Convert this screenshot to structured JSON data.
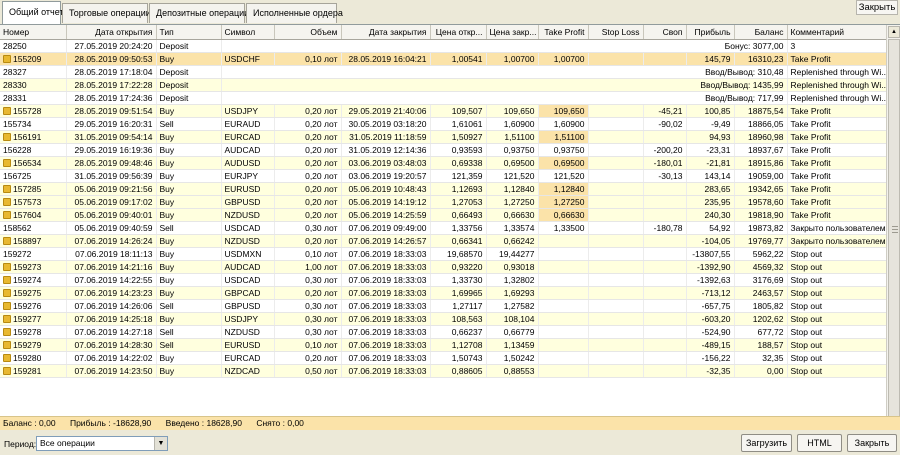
{
  "tabs": [
    "Общий отчет",
    "Торговые операции",
    "Депозитные операции",
    "Исполненные ордера"
  ],
  "close_top_label": "Закрыть",
  "columns": [
    "Номер",
    "Дата открытия",
    "Тип",
    "Символ",
    "Объем",
    "Дата закрытия",
    "Цена откр...",
    "Цена закр...",
    "Take Profit",
    "Stop Loss",
    "Своп",
    "Прибыль",
    "Баланс",
    "Комментарий"
  ],
  "rows": [
    {
      "kind": "bal",
      "icon": false,
      "style": "w",
      "c": [
        "28250",
        "27.05.2019 20:24:20",
        "Deposit"
      ],
      "span": "Бонус: 3077,00",
      "comment": "3"
    },
    {
      "kind": "trade",
      "icon": true,
      "style": "sel",
      "c": [
        "155209",
        "28.05.2019 09:50:53",
        "Buy",
        "USDCHF",
        "0,10 лот",
        "28.05.2019 16:04:21",
        "1,00541",
        "1,00700",
        "1,00700",
        "",
        "",
        "145,79",
        "16310,23",
        "Take Profit"
      ]
    },
    {
      "kind": "bal",
      "icon": false,
      "style": "w",
      "c": [
        "28327",
        "28.05.2019 17:18:04",
        "Deposit"
      ],
      "span": "Ввод/Вывод: 310,48",
      "comment": "Replenished through Wi..."
    },
    {
      "kind": "bal",
      "icon": false,
      "style": "y",
      "c": [
        "28330",
        "28.05.2019 17:22:28",
        "Deposit"
      ],
      "span": "Ввод/Вывод: 1435,99",
      "comment": "Replenished through Wi..."
    },
    {
      "kind": "bal",
      "icon": false,
      "style": "w",
      "c": [
        "28331",
        "28.05.2019 17:24:36",
        "Deposit"
      ],
      "span": "Ввод/Вывод: 717,99",
      "comment": "Replenished through Wi..."
    },
    {
      "kind": "trade",
      "icon": true,
      "style": "y",
      "c": [
        "155728",
        "28.05.2019 09:51:54",
        "Buy",
        "USDJPY",
        "0,20 лот",
        "29.05.2019 21:40:06",
        "109,507",
        "109,650",
        "109,650",
        "",
        "-45,21",
        "100,85",
        "18875,54",
        "Take Profit"
      ]
    },
    {
      "kind": "trade",
      "icon": false,
      "style": "w",
      "c": [
        "155734",
        "29.05.2019 16:20:31",
        "Sell",
        "EURAUD",
        "0,20 лот",
        "30.05.2019 03:18:20",
        "1,61061",
        "1,60900",
        "1,60900",
        "",
        "-90,02",
        "-9,49",
        "18866,05",
        "Take Profit"
      ]
    },
    {
      "kind": "trade",
      "icon": true,
      "style": "y",
      "c": [
        "156191",
        "31.05.2019 09:54:14",
        "Buy",
        "EURCAD",
        "0,20 лот",
        "31.05.2019 11:18:59",
        "1,50927",
        "1,51100",
        "1,51100",
        "",
        "",
        "94,93",
        "18960,98",
        "Take Profit"
      ]
    },
    {
      "kind": "trade",
      "icon": false,
      "style": "w",
      "c": [
        "156228",
        "29.05.2019 16:19:36",
        "Buy",
        "AUDCAD",
        "0,20 лот",
        "31.05.2019 12:14:36",
        "0,93593",
        "0,93750",
        "0,93750",
        "",
        "-200,20",
        "-23,31",
        "18937,67",
        "Take Profit"
      ]
    },
    {
      "kind": "trade",
      "icon": true,
      "style": "y",
      "c": [
        "156534",
        "28.05.2019 09:48:46",
        "Buy",
        "AUDUSD",
        "0,20 лот",
        "03.06.2019 03:48:03",
        "0,69338",
        "0,69500",
        "0,69500",
        "",
        "-180,01",
        "-21,81",
        "18915,86",
        "Take Profit"
      ]
    },
    {
      "kind": "trade",
      "icon": false,
      "style": "w",
      "c": [
        "156725",
        "31.05.2019 09:56:39",
        "Buy",
        "EURJPY",
        "0,20 лот",
        "03.06.2019 19:20:57",
        "121,359",
        "121,520",
        "121,520",
        "",
        "-30,13",
        "143,14",
        "19059,00",
        "Take Profit"
      ]
    },
    {
      "kind": "trade",
      "icon": true,
      "style": "y",
      "c": [
        "157285",
        "05.06.2019 09:21:56",
        "Buy",
        "EURUSD",
        "0,20 лот",
        "05.06.2019 10:48:43",
        "1,12693",
        "1,12840",
        "1,12840",
        "",
        "",
        "283,65",
        "19342,65",
        "Take Profit"
      ]
    },
    {
      "kind": "trade",
      "icon": true,
      "style": "y",
      "c": [
        "157573",
        "05.06.2019 09:17:02",
        "Buy",
        "GBPUSD",
        "0,20 лот",
        "05.06.2019 14:19:12",
        "1,27053",
        "1,27250",
        "1,27250",
        "",
        "",
        "235,95",
        "19578,60",
        "Take Profit"
      ]
    },
    {
      "kind": "trade",
      "icon": true,
      "style": "y",
      "c": [
        "157604",
        "05.06.2019 09:40:01",
        "Buy",
        "NZDUSD",
        "0,20 лот",
        "05.06.2019 14:25:59",
        "0,66493",
        "0,66630",
        "0,66630",
        "",
        "",
        "240,30",
        "19818,90",
        "Take Profit"
      ]
    },
    {
      "kind": "trade",
      "icon": false,
      "style": "w",
      "c": [
        "158562",
        "05.06.2019 09:40:59",
        "Sell",
        "USDCAD",
        "0,30 лот",
        "07.06.2019 09:49:00",
        "1,33756",
        "1,33574",
        "1,33500",
        "",
        "-180,78",
        "54,92",
        "19873,82",
        "Закрыто пользователем"
      ]
    },
    {
      "kind": "trade",
      "icon": true,
      "style": "y",
      "c": [
        "158897",
        "07.06.2019 14:26:24",
        "Buy",
        "NZDUSD",
        "0,20 лот",
        "07.06.2019 14:26:57",
        "0,66341",
        "0,66242",
        "",
        "",
        "",
        "-104,05",
        "19769,77",
        "Закрыто пользователем"
      ]
    },
    {
      "kind": "trade",
      "icon": false,
      "style": "w",
      "c": [
        "159272",
        "07.06.2019 18:11:13",
        "Buy",
        "USDMXN",
        "0,10 лот",
        "07.06.2019 18:33:03",
        "19,68570",
        "19,44277",
        "",
        "",
        "",
        "-13807,55",
        "5962,22",
        "Stop out"
      ]
    },
    {
      "kind": "trade",
      "icon": true,
      "style": "y",
      "c": [
        "159273",
        "07.06.2019 14:21:16",
        "Buy",
        "AUDCAD",
        "1,00 лот",
        "07.06.2019 18:33:03",
        "0,93220",
        "0,93018",
        "",
        "",
        "",
        "-1392,90",
        "4569,32",
        "Stop out"
      ]
    },
    {
      "kind": "trade",
      "icon": true,
      "style": "w",
      "c": [
        "159274",
        "07.06.2019 14:22:55",
        "Buy",
        "USDCAD",
        "0,30 лот",
        "07.06.2019 18:33:03",
        "1,33730",
        "1,32802",
        "",
        "",
        "",
        "-1392,63",
        "3176,69",
        "Stop out"
      ]
    },
    {
      "kind": "trade",
      "icon": true,
      "style": "y",
      "c": [
        "159275",
        "07.06.2019 14:23:23",
        "Buy",
        "GBPCAD",
        "0,20 лот",
        "07.06.2019 18:33:03",
        "1,69965",
        "1,69293",
        "",
        "",
        "",
        "-713,12",
        "2463,57",
        "Stop out"
      ]
    },
    {
      "kind": "trade",
      "icon": true,
      "style": "w",
      "c": [
        "159276",
        "07.06.2019 14:26:06",
        "Sell",
        "GBPUSD",
        "0,30 лот",
        "07.06.2019 18:33:03",
        "1,27117",
        "1,27582",
        "",
        "",
        "",
        "-657,75",
        "1805,82",
        "Stop out"
      ]
    },
    {
      "kind": "trade",
      "icon": true,
      "style": "y",
      "c": [
        "159277",
        "07.06.2019 14:25:18",
        "Buy",
        "USDJPY",
        "0,30 лот",
        "07.06.2019 18:33:03",
        "108,563",
        "108,104",
        "",
        "",
        "",
        "-603,20",
        "1202,62",
        "Stop out"
      ]
    },
    {
      "kind": "trade",
      "icon": true,
      "style": "w",
      "c": [
        "159278",
        "07.06.2019 14:27:18",
        "Sell",
        "NZDUSD",
        "0,30 лот",
        "07.06.2019 18:33:03",
        "0,66237",
        "0,66779",
        "",
        "",
        "",
        "-524,90",
        "677,72",
        "Stop out"
      ]
    },
    {
      "kind": "trade",
      "icon": true,
      "style": "y",
      "c": [
        "159279",
        "07.06.2019 14:28:30",
        "Sell",
        "EURUSD",
        "0,10 лот",
        "07.06.2019 18:33:03",
        "1,12708",
        "1,13459",
        "",
        "",
        "",
        "-489,15",
        "188,57",
        "Stop out"
      ]
    },
    {
      "kind": "trade",
      "icon": true,
      "style": "w",
      "c": [
        "159280",
        "07.06.2019 14:22:02",
        "Buy",
        "EURCAD",
        "0,20 лот",
        "07.06.2019 18:33:03",
        "1,50743",
        "1,50242",
        "",
        "",
        "",
        "-156,22",
        "32,35",
        "Stop out"
      ]
    },
    {
      "kind": "trade",
      "icon": true,
      "style": "y",
      "c": [
        "159281",
        "07.06.2019 14:23:50",
        "Buy",
        "NZDCAD",
        "0,50 лот",
        "07.06.2019 18:33:03",
        "0,88605",
        "0,88553",
        "",
        "",
        "",
        "-32,35",
        "0,00",
        "Stop out"
      ]
    }
  ],
  "status": {
    "balance": "Баланс : 0,00",
    "profit": "Прибыль : -18628,90",
    "deposited": "Введено : 18628,90",
    "withdrawn": "Снято : 0,00"
  },
  "period_label": "Период:",
  "period_value": "Все операции",
  "buttons": {
    "load": "Загрузить",
    "html": "HTML",
    "close": "Закрыть"
  }
}
